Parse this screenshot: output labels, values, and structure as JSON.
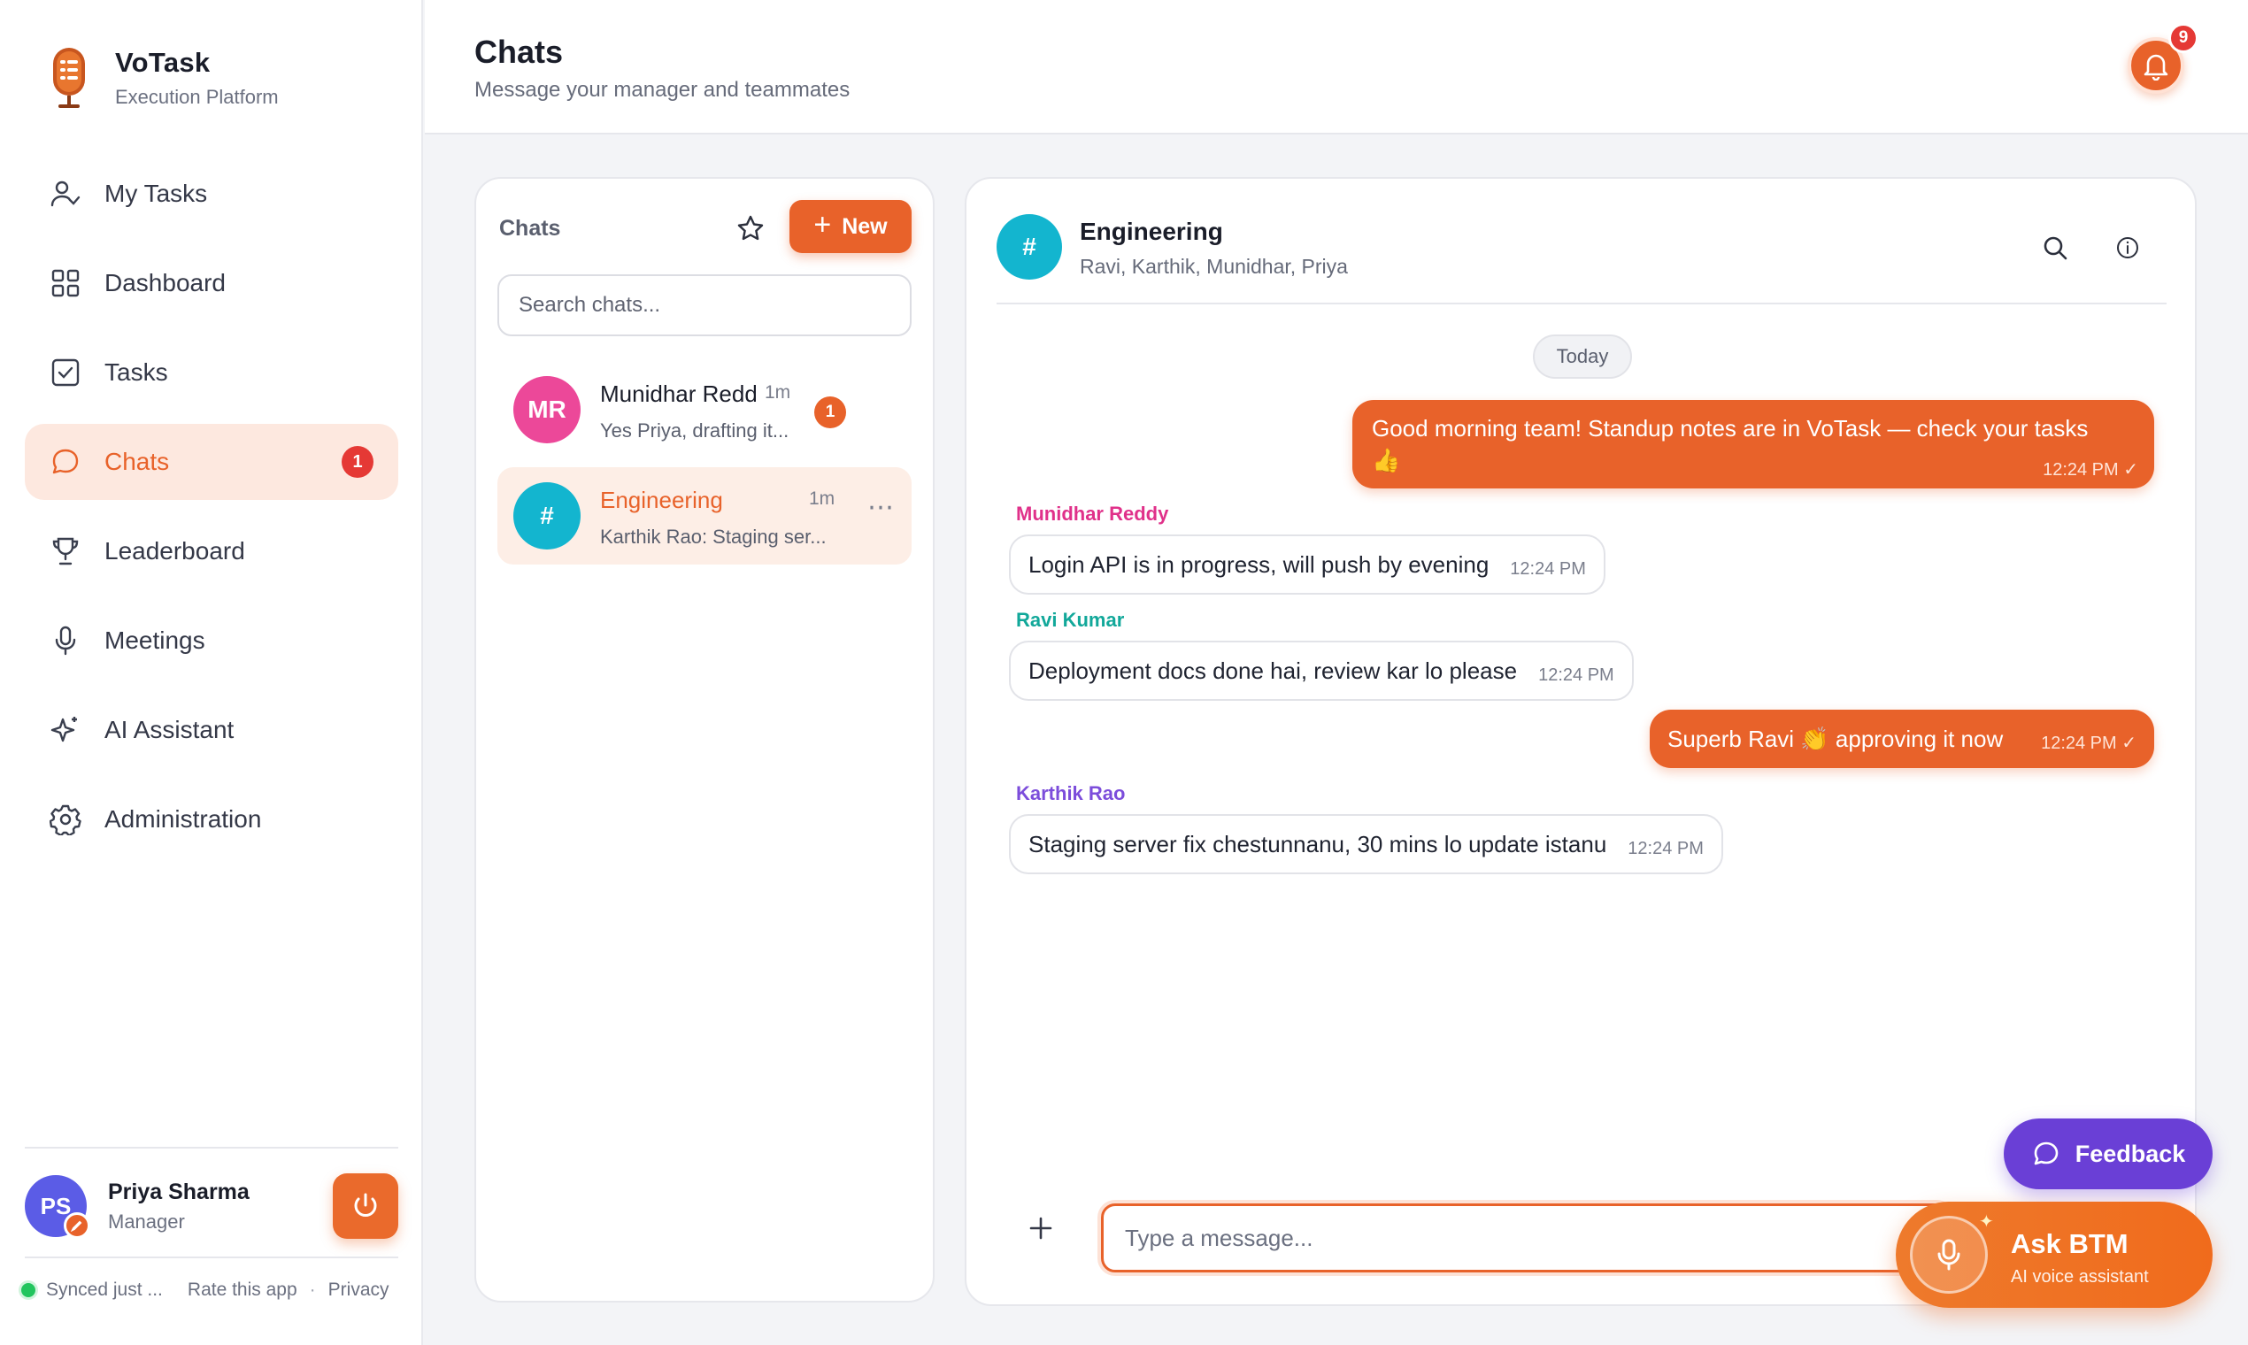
{
  "brand": {
    "name": "VoTask",
    "subtitle": "Execution Platform"
  },
  "sidebar": {
    "items": [
      {
        "label": "My Tasks",
        "icon": "user-check-icon"
      },
      {
        "label": "Dashboard",
        "icon": "grid-icon"
      },
      {
        "label": "Tasks",
        "icon": "checkbox-icon"
      },
      {
        "label": "Chats",
        "icon": "chat-bubble-icon",
        "active": true,
        "badge": "1"
      },
      {
        "label": "Leaderboard",
        "icon": "trophy-icon"
      },
      {
        "label": "Meetings",
        "icon": "microphone-icon"
      },
      {
        "label": "AI Assistant",
        "icon": "sparkle-icon"
      },
      {
        "label": "Administration",
        "icon": "gear-icon"
      }
    ],
    "user": {
      "initials": "PS",
      "name": "Priya Sharma",
      "role": "Manager"
    },
    "footer": {
      "sync": "Synced just ...",
      "rate": "Rate this app",
      "privacy": "Privacy"
    }
  },
  "header": {
    "title": "Chats",
    "subtitle": "Message your manager and teammates",
    "notifications": "9"
  },
  "chat_list": {
    "title": "Chats",
    "new_label": "New",
    "search_placeholder": "Search chats...",
    "chats": [
      {
        "initials": "MR",
        "name": "Munidhar Reddy",
        "time": "1m",
        "preview": "Yes Priya, drafting it...",
        "unread": "1",
        "color": "#ec4899"
      },
      {
        "initials": "#",
        "name": "Engineering",
        "time": "1m",
        "preview": "Karthik Rao: Staging ser...",
        "active": true,
        "color": "#13b5cf",
        "more": "⋯"
      }
    ]
  },
  "conversation": {
    "name": "Engineering",
    "initials": "#",
    "members": "Ravi, Karthik, Munidhar, Priya",
    "day": "Today",
    "messages": [
      {
        "direction": "out",
        "text": "Good morning team! Standup notes are in VoTask — check your tasks 👍",
        "time": "12:24 PM ✓"
      },
      {
        "direction": "in",
        "sender": "Munidhar Reddy",
        "sender_color": "#e0318a",
        "text": "Login API is in progress, will push by evening",
        "time": "12:24 PM"
      },
      {
        "direction": "in",
        "sender": "Ravi Kumar",
        "sender_color": "#12a89a",
        "text": "Deployment docs done hai, review kar lo please",
        "time": "12:24 PM"
      },
      {
        "direction": "out",
        "text": "Superb Ravi 👏 approving it now",
        "time": "12:24 PM ✓"
      },
      {
        "direction": "in",
        "sender": "Karthik Rao",
        "sender_color": "#7c4ddb",
        "text": "Staging server fix chestunnanu, 30 mins lo update istanu",
        "time": "12:24 PM"
      }
    ],
    "input_placeholder": "Type a message..."
  },
  "floating": {
    "feedback": "Feedback",
    "ask_title": "Ask BTM",
    "ask_sub": "AI voice assistant"
  },
  "colors": {
    "accent": "#e8622a",
    "danger": "#e53935",
    "purple": "#6a3fd6",
    "teal": "#13b5cf"
  }
}
